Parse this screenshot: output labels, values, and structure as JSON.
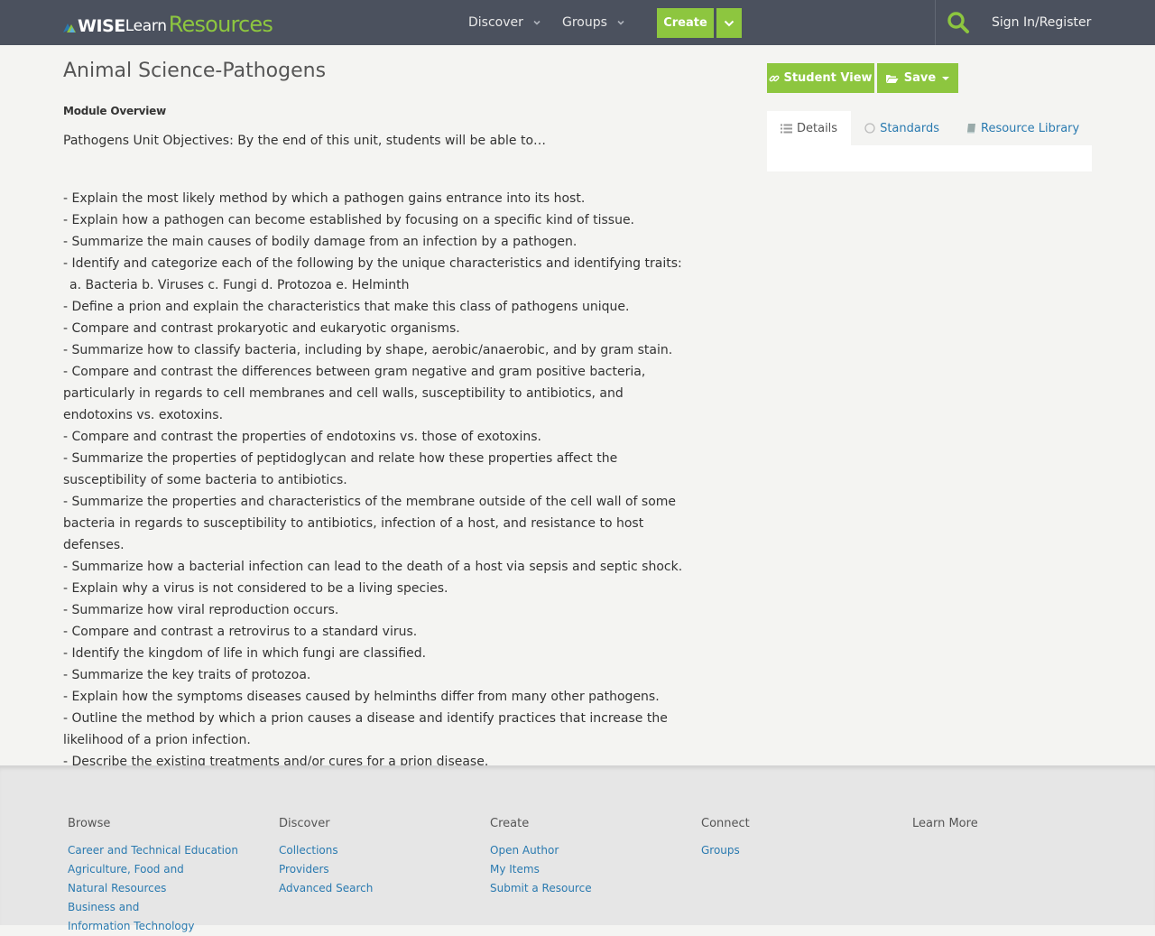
{
  "header": {
    "logo": {
      "wise": "WISE",
      "learn": "Learn",
      "resources": "Resources"
    },
    "nav": [
      {
        "label": "Discover"
      },
      {
        "label": "Groups"
      }
    ],
    "create_label": "Create",
    "signin_label": "Sign In/Register",
    "accent": "#8dc63f",
    "bar_color": "#4b515e"
  },
  "main": {
    "title": "Animal Science-Pathogens",
    "section_label": "Module Overview",
    "intro": "Pathogens Unit Objectives: By the end of this unit, students will be able to…",
    "objectives": [
      "- Explain the most likely method by which a pathogen gains entrance into its host.",
      "- Explain how a pathogen can become established by focusing on a specific kind of tissue.",
      "- Summarize the main causes of bodily damage from an infection by a pathogen.",
      "- Identify and categorize each of the following by the unique characteristics and identifying traits:",
      "a. Bacteria b. Viruses c. Fungi d. Protozoa e. Helminth",
      "- Define a prion and explain the characteristics that make this class of pathogens unique.",
      "- Compare and contrast prokaryotic and eukaryotic organisms.",
      "- Summarize how to classify bacteria, including by shape, aerobic/anaerobic, and by gram stain.",
      "- Compare and contrast the differences between gram negative and gram positive bacteria, particularly in regards to cell membranes and cell walls, susceptibility to antibiotics, and endotoxins vs. exotoxins.",
      "- Compare and contrast the properties of endotoxins vs. those of exotoxins.",
      "- Summarize the properties of peptidoglycan and relate how these properties affect the susceptibility of some bacteria to antibiotics.",
      "- Summarize the properties and characteristics of the membrane outside of the cell wall of some bacteria in regards to susceptibility to antibiotics, infection of a host, and resistance to host defenses.",
      "- Summarize how a bacterial infection can lead to the death of a host via sepsis and septic shock.",
      "- Explain why a virus is not considered to be a living species.",
      "- Summarize how viral reproduction occurs.",
      "- Compare and contrast a retrovirus to a standard virus.",
      "- Identify the kingdom of life in which fungi are classified.",
      "- Summarize the key traits of protozoa.",
      "- Explain how the symptoms diseases caused by helminths differ from many other pathogens.",
      "- Outline the method by which a prion causes a disease and identify practices that increase the likelihood of a prion infection.",
      "- Describe the existing treatments and/or cures for a prion disease."
    ]
  },
  "sidebar": {
    "student_view_label": "Student View",
    "save_label": "Save",
    "tabs": [
      {
        "label": "Details",
        "icon": "list-icon"
      },
      {
        "label": "Standards",
        "icon": "circle-icon"
      },
      {
        "label": "Resource Library",
        "icon": "book-icon"
      }
    ]
  },
  "footer": {
    "columns": [
      {
        "title": "Browse",
        "links": [
          "Career and Technical Education",
          "Agriculture, Food and Natural Resources",
          "Business and Information Technology"
        ]
      },
      {
        "title": "Discover",
        "links": [
          "Collections",
          "Providers",
          "Advanced Search"
        ]
      },
      {
        "title": "Create",
        "links": [
          "Open Author",
          "My Items",
          "Submit a Resource"
        ]
      },
      {
        "title": "Connect",
        "links": [
          "Groups"
        ]
      },
      {
        "title": "Learn More",
        "links": []
      }
    ]
  }
}
